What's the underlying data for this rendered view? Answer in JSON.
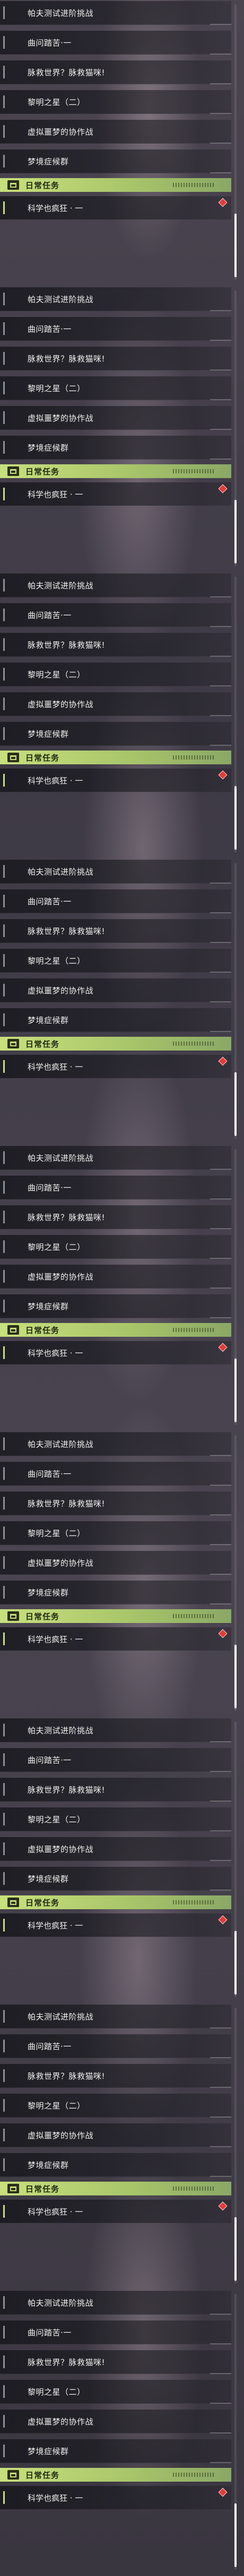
{
  "quests": [
    "帕夫测试进阶挑战",
    "曲问踏苦·一",
    "脉救世界？脉救猫咪!",
    "黎明之星（二）",
    "虚拟噩梦的协作战",
    "梦境症候群"
  ],
  "daily": {
    "title": "日常任务",
    "quest": "科学也疯狂 · 一"
  },
  "block_count": 9,
  "colors": {
    "banner_green": "#c8e07c",
    "alert_red": "#e23b3b"
  },
  "icons": [
    "calendar-icon",
    "alert-diamond-icon"
  ]
}
